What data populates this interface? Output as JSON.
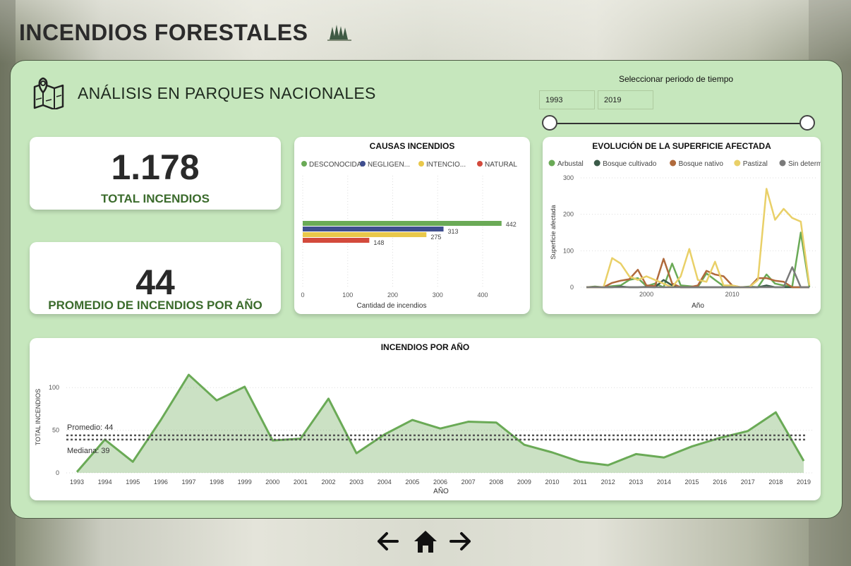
{
  "page": {
    "title": "INCENDIOS FORESTALES",
    "subtitle": "ANÁLISIS EN PARQUES NACIONALES"
  },
  "period": {
    "label": "Seleccionar periodo de tiempo",
    "start": "1993",
    "end": "2019"
  },
  "kpis": {
    "total_value": "1.178",
    "total_label": "TOTAL INCENDIOS",
    "avg_value": "44",
    "avg_label": "PROMEDIO DE INCENDIOS POR AÑO"
  },
  "icons": [
    "trees-icon",
    "map-icon",
    "arrow-left-icon",
    "home-icon",
    "arrow-right-icon"
  ],
  "chart_data": [
    {
      "type": "bar",
      "title": "CAUSAS INCENDIOS",
      "orientation": "horizontal",
      "xlabel": "Cantidad de incendios",
      "xticks": [
        "0",
        "100",
        "200",
        "300",
        "400"
      ],
      "xlim": [
        0,
        450
      ],
      "legend_position": "top",
      "series": [
        {
          "name": "DESCONOCIDA",
          "value": 442,
          "color": "#6aaa56"
        },
        {
          "name": "NEGLIGEN...",
          "value": 313,
          "color": "#3f4e8f"
        },
        {
          "name": "INTENCIO...",
          "value": 275,
          "color": "#e9c84a"
        },
        {
          "name": "NATURAL",
          "value": 148,
          "color": "#d34a3c"
        }
      ]
    },
    {
      "type": "line",
      "title": "EVOLUCIÓN DE LA SUPERFICIE AFECTADA",
      "xlabel": "Año",
      "ylabel": "Superficie afectada",
      "xticks": [
        "2000",
        "2010"
      ],
      "yticks": [
        "0",
        "100",
        "200",
        "300"
      ],
      "ylim": [
        0,
        300
      ],
      "legend_position": "top",
      "x": [
        1993,
        1994,
        1995,
        1996,
        1997,
        1998,
        1999,
        2000,
        2001,
        2002,
        2003,
        2004,
        2005,
        2006,
        2007,
        2008,
        2009,
        2010,
        2011,
        2012,
        2013,
        2014,
        2015,
        2016,
        2017,
        2018,
        2019
      ],
      "series": [
        {
          "name": "Arbustal",
          "color": "#6aaa56",
          "values": [
            0,
            2,
            0,
            3,
            5,
            20,
            25,
            3,
            10,
            0,
            65,
            5,
            3,
            1,
            38,
            20,
            3,
            2,
            0,
            2,
            0,
            35,
            10,
            5,
            2,
            150,
            0
          ]
        },
        {
          "name": "Bosque cultivado",
          "color": "#3a5a48",
          "values": [
            0,
            1,
            0,
            0,
            2,
            0,
            0,
            1,
            0,
            20,
            5,
            0,
            0,
            0,
            0,
            0,
            0,
            0,
            0,
            0,
            0,
            5,
            0,
            0,
            0,
            0,
            0
          ]
        },
        {
          "name": "Bosque nativo",
          "color": "#b06a3c",
          "values": [
            0,
            0,
            0,
            12,
            18,
            22,
            48,
            5,
            3,
            78,
            10,
            0,
            0,
            5,
            45,
            35,
            30,
            5,
            0,
            0,
            25,
            25,
            18,
            15,
            0,
            0,
            0
          ]
        },
        {
          "name": "Pastizal",
          "color": "#e9d068",
          "values": [
            0,
            0,
            0,
            80,
            65,
            30,
            20,
            30,
            20,
            10,
            0,
            30,
            105,
            20,
            15,
            70,
            5,
            5,
            0,
            0,
            20,
            270,
            185,
            215,
            190,
            180,
            5
          ]
        },
        {
          "name": "Sin determinar",
          "color": "#7a7a7a",
          "values": [
            0,
            0,
            0,
            0,
            0,
            0,
            0,
            0,
            0,
            0,
            0,
            0,
            0,
            0,
            0,
            0,
            0,
            0,
            0,
            0,
            0,
            0,
            0,
            0,
            55,
            0,
            0
          ]
        }
      ]
    },
    {
      "type": "area",
      "title": "INCENDIOS POR AÑO",
      "xlabel": "AÑO",
      "ylabel": "TOTAL INCENDIOS",
      "yticks": [
        "0",
        "50",
        "100"
      ],
      "ylim": [
        0,
        125
      ],
      "categories": [
        "1993",
        "1994",
        "1995",
        "1996",
        "1997",
        "1998",
        "1999",
        "2000",
        "2001",
        "2002",
        "2003",
        "2004",
        "2005",
        "2006",
        "2007",
        "2008",
        "2009",
        "2010",
        "2011",
        "2012",
        "2013",
        "2014",
        "2015",
        "2016",
        "2017",
        "2018",
        "2019"
      ],
      "values": [
        1,
        39,
        13,
        62,
        115,
        85,
        101,
        38,
        40,
        87,
        23,
        45,
        62,
        52,
        60,
        59,
        33,
        24,
        13,
        9,
        22,
        18,
        31,
        41,
        49,
        71,
        14
      ],
      "color": "#6aaa56",
      "reference_lines": [
        {
          "label": "Promedio",
          "label_text": "Promedio: 44",
          "value": 44
        },
        {
          "label": "Mediana",
          "label_text": "Mediana: 39",
          "value": 39
        }
      ]
    }
  ]
}
